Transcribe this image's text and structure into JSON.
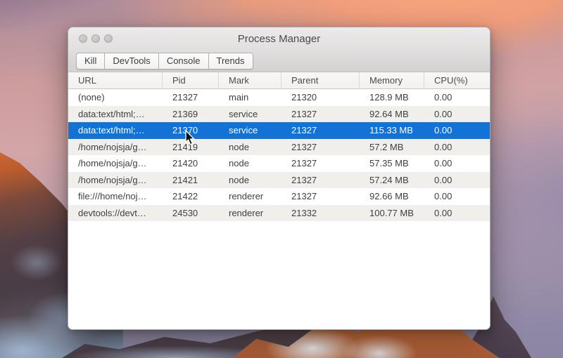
{
  "window": {
    "title": "Process Manager",
    "toolbar": {
      "buttons": [
        {
          "label": "Kill"
        },
        {
          "label": "DevTools"
        },
        {
          "label": "Console"
        },
        {
          "label": "Trends"
        }
      ]
    },
    "table": {
      "columns": [
        "URL",
        "Pid",
        "Mark",
        "Parent",
        "Memory",
        "CPU(%)"
      ],
      "rows": [
        [
          "(none)",
          "21327",
          "main",
          "21320",
          "128.9 MB",
          "0.00"
        ],
        [
          "data:text/html;…",
          "21369",
          "service",
          "21327",
          "92.64 MB",
          "0.00"
        ],
        [
          "data:text/html;…",
          "21370",
          "service",
          "21327",
          "115.33 MB",
          "0.00"
        ],
        [
          "/home/nojsja/g…",
          "21419",
          "node",
          "21327",
          "57.2 MB",
          "0.00"
        ],
        [
          "/home/nojsja/g…",
          "21420",
          "node",
          "21327",
          "57.35 MB",
          "0.00"
        ],
        [
          "/home/nojsja/g…",
          "21421",
          "node",
          "21327",
          "57.24 MB",
          "0.00"
        ],
        [
          "file:///home/noj…",
          "21422",
          "renderer",
          "21327",
          "92.66 MB",
          "0.00"
        ],
        [
          "devtools://devt…",
          "24530",
          "renderer",
          "21332",
          "100.77 MB",
          "0.00"
        ]
      ],
      "selected_row_index": 2
    }
  },
  "colors": {
    "selection_blue": "#1272d6",
    "row_stripe": "#f0efec",
    "titlebar_gray": "#e6e3e3",
    "sky_salmon": "#f09d7b",
    "sky_lavender": "#8c85a4",
    "mountain_orange": "#cc703d"
  }
}
